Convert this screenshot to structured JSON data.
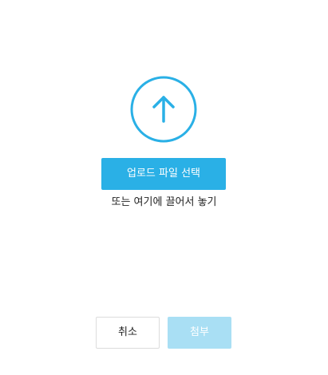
{
  "upload": {
    "icon": "arrow-up-circle-icon",
    "button_label": "업로드 파일 선택",
    "drop_hint": "또는 여기에 끌어서 놓기"
  },
  "footer": {
    "cancel_label": "취소",
    "attach_label": "첨부",
    "attach_enabled": false
  },
  "colors": {
    "accent": "#2ab0e6",
    "accent_disabled": "#a9dff4",
    "border": "#dcdcdc",
    "text": "#222222"
  }
}
